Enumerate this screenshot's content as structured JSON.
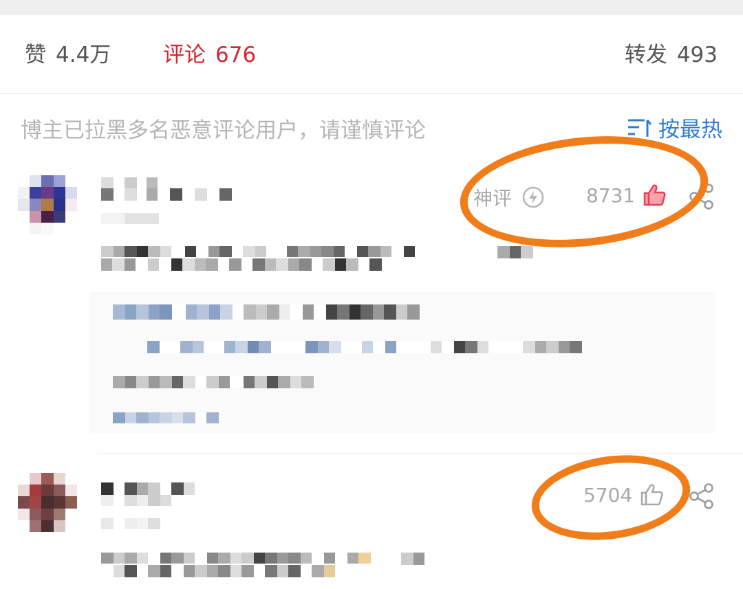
{
  "tabs": {
    "like": {
      "label": "赞",
      "count": "4.4万"
    },
    "comment": {
      "label": "评论",
      "count": "676"
    },
    "repost": {
      "label": "转发",
      "count": "493"
    }
  },
  "notice": "博主已拉黑多名恶意评论用户，请谨慎评论",
  "sort_label": "按最热",
  "comments": [
    {
      "badge": "神评",
      "likes": "8731",
      "liked": true
    },
    {
      "likes": "5704",
      "liked": false
    }
  ],
  "colors": {
    "accent_red": "#d3272e",
    "link_blue": "#2e7fd0",
    "annotation_orange": "#f07c1a"
  },
  "icons": [
    "lightning-icon",
    "thumbs-up-icon",
    "share-icon",
    "sort-icon"
  ]
}
